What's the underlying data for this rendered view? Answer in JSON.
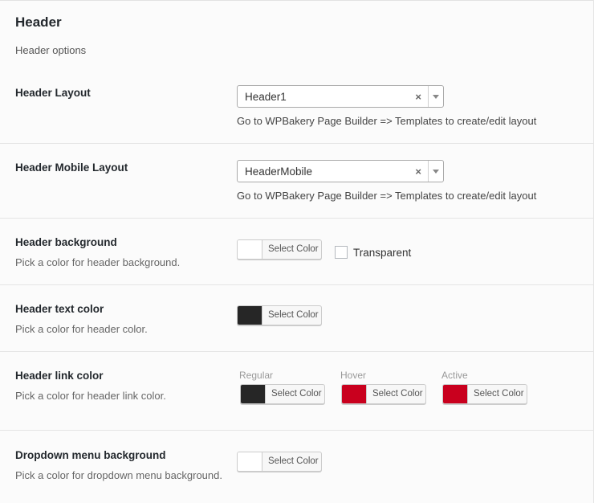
{
  "section": {
    "title": "Header",
    "description": "Header options"
  },
  "header_layout": {
    "label": "Header Layout",
    "value": "Header1",
    "clear": "×",
    "hint": "Go to WPBakery Page Builder => Templates to create/edit layout"
  },
  "header_mobile_layout": {
    "label": "Header Mobile Layout",
    "value": "HeaderMobile",
    "clear": "×",
    "hint": "Go to WPBakery Page Builder => Templates to create/edit layout"
  },
  "header_background": {
    "label": "Header background",
    "description": "Pick a color for header background.",
    "button": "Select Color",
    "color": "#ffffff",
    "transparent_label": "Transparent",
    "transparent_checked": false
  },
  "header_text_color": {
    "label": "Header text color",
    "description": "Pick a color for header color.",
    "button": "Select Color",
    "color": "#262626"
  },
  "header_link_color": {
    "label": "Header link color",
    "description": "Pick a color for header link color.",
    "states": [
      {
        "label": "Regular",
        "button": "Select Color",
        "color": "#262626"
      },
      {
        "label": "Hover",
        "button": "Select Color",
        "color": "#c9001e"
      },
      {
        "label": "Active",
        "button": "Select Color",
        "color": "#c9001e"
      }
    ]
  },
  "dropdown_menu_background": {
    "label": "Dropdown menu background",
    "description": "Pick a color for dropdown menu background.",
    "button": "Select Color",
    "color": "#ffffff"
  }
}
